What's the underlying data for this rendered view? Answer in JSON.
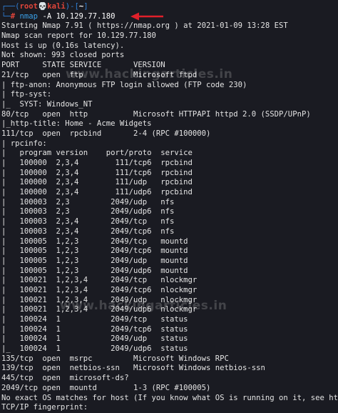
{
  "prompt": {
    "bracket_open": "┌──(",
    "user": "root",
    "skull": "💀",
    "host": "kali",
    "mid": ")-[",
    "path": "~",
    "bracket_close": "]",
    "prefix": "└─",
    "hash": "#",
    "command_tool": "nmap",
    "command_args": " -A 10.129.77.180"
  },
  "output": [
    "Starting Nmap 7.91 ( https://nmap.org ) at 2021-01-09 13:28 EST",
    "Nmap scan report for 10.129.77.180",
    "Host is up (0.16s latency).",
    "Not shown: 993 closed ports",
    "PORT     STATE SERVICE       VERSION",
    "21/tcp   open  ftp           Microsoft ftpd",
    "| ftp-anon: Anonymous FTP login allowed (FTP code 230)",
    "| ftp-syst:",
    "|_  SYST: Windows_NT",
    "80/tcp   open  http          Microsoft HTTPAPI httpd 2.0 (SSDP/UPnP)",
    "|_http-title: Home - Acme Widgets",
    "111/tcp  open  rpcbind       2-4 (RPC #100000)",
    "| rpcinfo:",
    "|   program version    port/proto  service",
    "|   100000  2,3,4        111/tcp6  rpcbind",
    "|   100000  2,3,4        111/tcp6  rpcbind",
    "|   100000  2,3,4        111/udp   rpcbind",
    "|   100000  2,3,4        111/udp6  rpcbind",
    "|   100003  2,3         2049/udp   nfs",
    "|   100003  2,3         2049/udp6  nfs",
    "|   100003  2,3,4       2049/tcp   nfs",
    "|   100003  2,3,4       2049/tcp6  nfs",
    "|   100005  1,2,3       2049/tcp   mountd",
    "|   100005  1,2,3       2049/tcp6  mountd",
    "|   100005  1,2,3       2049/udp   mountd",
    "|   100005  1,2,3       2049/udp6  mountd",
    "|   100021  1,2,3,4     2049/tcp   nlockmgr",
    "|   100021  1,2,3,4     2049/tcp6  nlockmgr",
    "|   100021  1,2,3,4     2049/udp   nlockmgr",
    "|   100021  1,2,3,4     2049/udp6  nlockmgr",
    "|   100024  1           2049/tcp   status",
    "|   100024  1           2049/tcp6  status",
    "|   100024  1           2049/udp   status",
    "|_  100024  1           2049/udp6  status",
    "135/tcp  open  msrpc         Microsoft Windows RPC",
    "139/tcp  open  netbios-ssn   Microsoft Windows netbios-ssn",
    "445/tcp  open  microsoft-ds?",
    "2049/tcp open  mountd        1-3 (RPC #100005)",
    "No exact OS matches for host (If you know what OS is running on it, see https://nmap.org/submit/ ).",
    "TCP/IP fingerprint:"
  ],
  "watermarks": [
    "www.hackingarticles.in",
    "www.hackingarticles.in"
  ],
  "colors": {
    "background": "#1a1b22",
    "prompt_blue": "#2e7fd6",
    "prompt_red": "#e0453a",
    "arrow_red": "#e0202a",
    "text": "#e4e4e4"
  }
}
